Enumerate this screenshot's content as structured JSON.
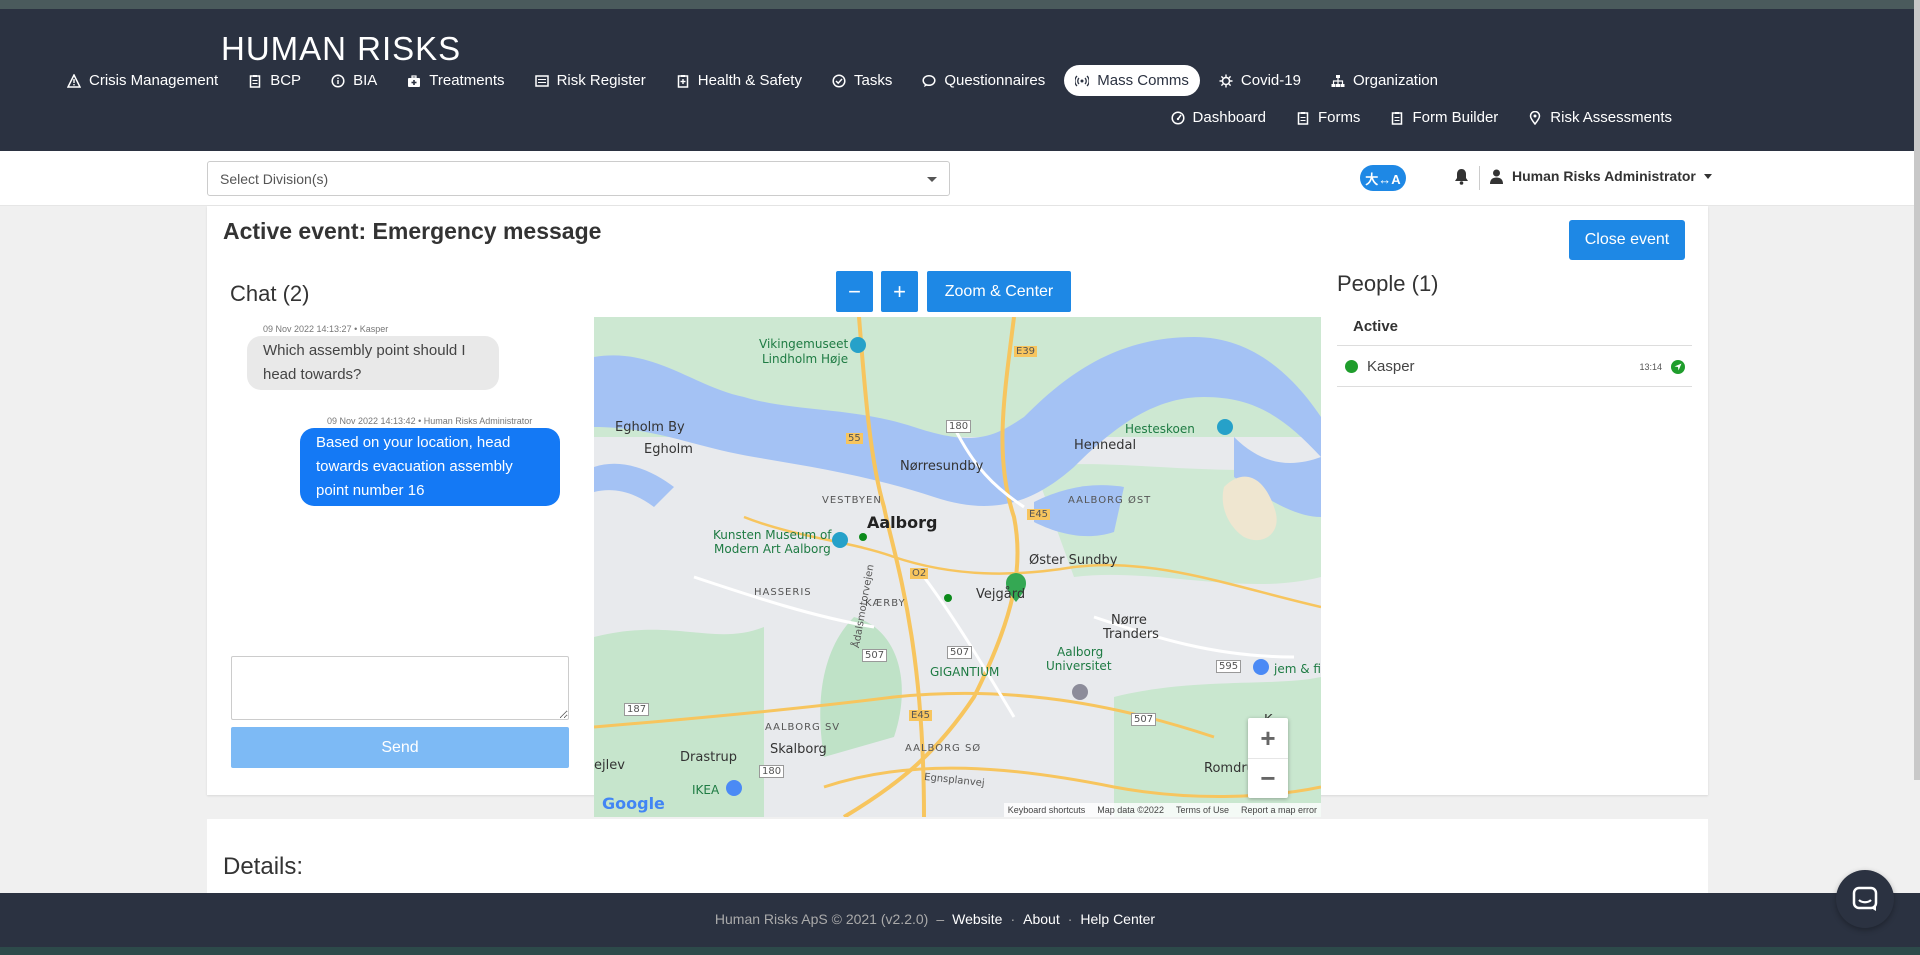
{
  "brand": {
    "name": "HUMAN RISKS"
  },
  "nav": {
    "row1": [
      {
        "label": "Crisis Management",
        "icon": "warning-icon"
      },
      {
        "label": "BCP",
        "icon": "clipboard-icon"
      },
      {
        "label": "BIA",
        "icon": "info-icon"
      },
      {
        "label": "Treatments",
        "icon": "medkit-icon"
      },
      {
        "label": "Risk Register",
        "icon": "list-icon"
      },
      {
        "label": "Health & Safety",
        "icon": "clipboard-plus-icon"
      },
      {
        "label": "Tasks",
        "icon": "check-circle-icon"
      },
      {
        "label": "Questionnaires",
        "icon": "comment-icon"
      },
      {
        "label": "Mass Comms",
        "icon": "broadcast-icon",
        "active": true
      },
      {
        "label": "Covid-19",
        "icon": "virus-icon"
      },
      {
        "label": "Organization",
        "icon": "sitemap-icon"
      }
    ],
    "row2": [
      {
        "label": "Dashboard",
        "icon": "gauge-icon"
      },
      {
        "label": "Forms",
        "icon": "form-icon"
      },
      {
        "label": "Form Builder",
        "icon": "form-builder-icon"
      },
      {
        "label": "Risk Assessments",
        "icon": "map-pin-icon"
      }
    ]
  },
  "subbar": {
    "division_placeholder": "Select Division(s)",
    "lang_label": "大↔A",
    "user_name": "Human Risks Administrator"
  },
  "event": {
    "title": "Active event: Emergency message",
    "close_label": "Close event"
  },
  "chat": {
    "title": "Chat (2)",
    "messages": [
      {
        "meta": "09 Nov 2022 14:13:27 • Kasper",
        "line1": "Which assembly point should I",
        "line2": "head towards?",
        "line3": ""
      },
      {
        "meta": "09 Nov 2022 14:13:42 • Human Risks Administrator",
        "line1": "Based on your location, head",
        "line2": "towards evacuation assembly",
        "line3": "point number 16"
      }
    ],
    "send_label": "Send"
  },
  "map": {
    "zoom_out": "−",
    "zoom_in": "+",
    "zoom_center": "Zoom & Center",
    "labels": {
      "vikingemuseet": "Vikingemuseet",
      "lindholm": "Lindholm Høje",
      "egholm_by": "Egholm By",
      "egholm": "Egholm",
      "norresundby": "Nørresundby",
      "hennedal": "Hennedal",
      "hesteskoen": "Hesteskoen",
      "vestbyen": "VESTBYEN",
      "aalborg": "Aalborg",
      "aalborg_ost": "AALBORG ØST",
      "kunsten1": "Kunsten Museum of",
      "kunsten2": "Modern Art Aalborg",
      "oster_sundby": "Øster Sundby",
      "hasseris": "HASSERIS",
      "kaerby": "KÆRBY",
      "vejgaard": "Vejgård",
      "norre1": "Nørre",
      "norre2": "Tranders",
      "aau1": "Aalborg",
      "aau2": "Universitet",
      "gigantium": "GIGANTIUM",
      "jem": "jem & fi",
      "aalborg_sv": "AALBORG SV",
      "drastrup": "Drastrup",
      "skalborg": "Skalborg",
      "aalborg_so": "AALBORG SØ",
      "romdrup": "Romdrup",
      "ejlev": "ejlev",
      "ikea": "IKEA",
      "k": "K",
      "egnsplanvej": "Egnsplanvej",
      "adalsmotorvejen": "Ådalsmotorvejen",
      "r55": "55",
      "r180a": "180",
      "e39": "E39",
      "e45a": "E45",
      "e45b": "E45",
      "o2": "O2",
      "r507a": "507",
      "r507b": "507",
      "r507c": "507",
      "r187": "187",
      "r180b": "180",
      "r595": "595"
    },
    "google": "Google",
    "footer": [
      "Keyboard shortcuts",
      "Map data ©2022",
      "Terms of Use",
      "Report a map error"
    ],
    "ctrl_plus": "+",
    "ctrl_minus": "−"
  },
  "people": {
    "title": "People (1)",
    "header": "Active",
    "rows": [
      {
        "name": "Kasper",
        "time": "13:14"
      }
    ]
  },
  "details": {
    "title": "Details:"
  },
  "footer": {
    "copyright": "Human Risks ApS © 2021 (v2.2.0)",
    "dash": "–",
    "dot1": "·",
    "dot2": "·",
    "website": "Website",
    "about": "About",
    "help": "Help Center"
  },
  "colors": {
    "header_bg": "#2b3241",
    "primary": "#1e88e5",
    "chat_out": "#1479f5",
    "status_green": "#1f9d2c"
  }
}
